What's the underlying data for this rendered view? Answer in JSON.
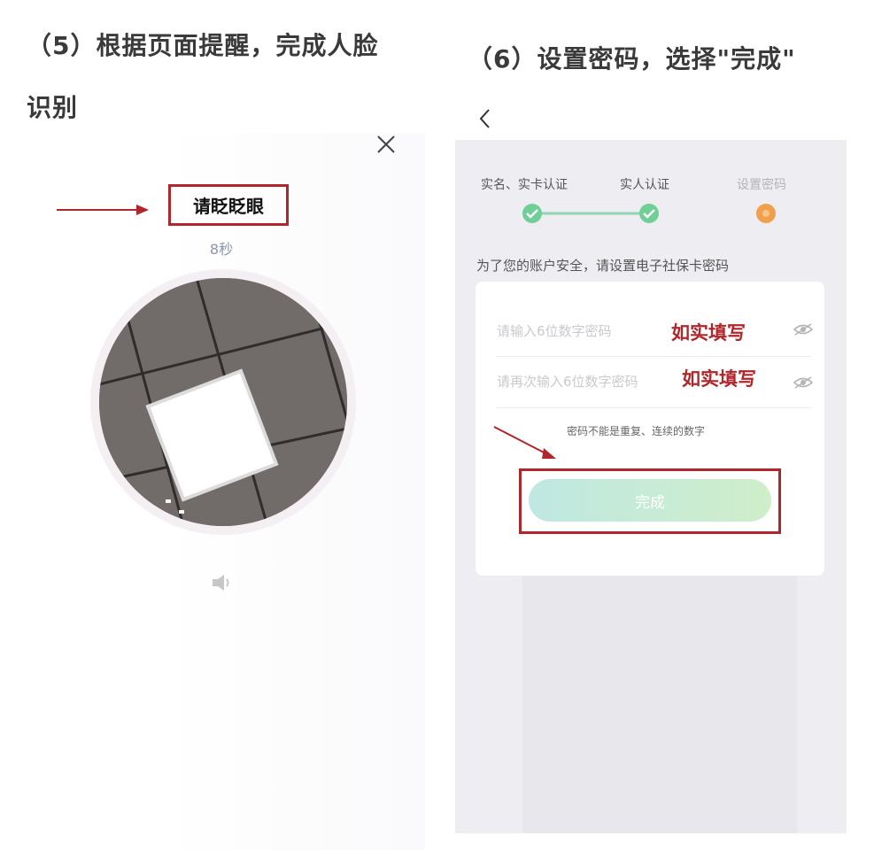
{
  "left": {
    "title_line1": "（5）根据页面提醒，完成人脸",
    "title_line2": "识别",
    "prompt": "请眨眨眼",
    "countdown": "8秒",
    "close_icon": "close-icon",
    "speaker_icon": "speaker-icon"
  },
  "right": {
    "title": "（6）设置密码，选择\"完成\"",
    "back_icon": "chevron-left-icon",
    "steps": [
      {
        "label": "实名、实卡认证",
        "status": "done"
      },
      {
        "label": "实人认证",
        "status": "done"
      },
      {
        "label": "设置密码",
        "status": "current"
      }
    ],
    "hint": "为了您的账户安全，请设置电子社保卡密码",
    "password_placeholder": "请输入6位数字密码",
    "confirm_placeholder": "请再次输入6位数字密码",
    "annotation": "如实填写",
    "rule": "密码不能是重复、连续的数字",
    "done_label": "完成"
  },
  "colors": {
    "annotation_red": "#b0262a",
    "step_done_green": "#6fcf97",
    "step_current_orange": "#f0a04b",
    "button_gradient": [
      "#bfe8e2",
      "#cfeec9"
    ]
  }
}
